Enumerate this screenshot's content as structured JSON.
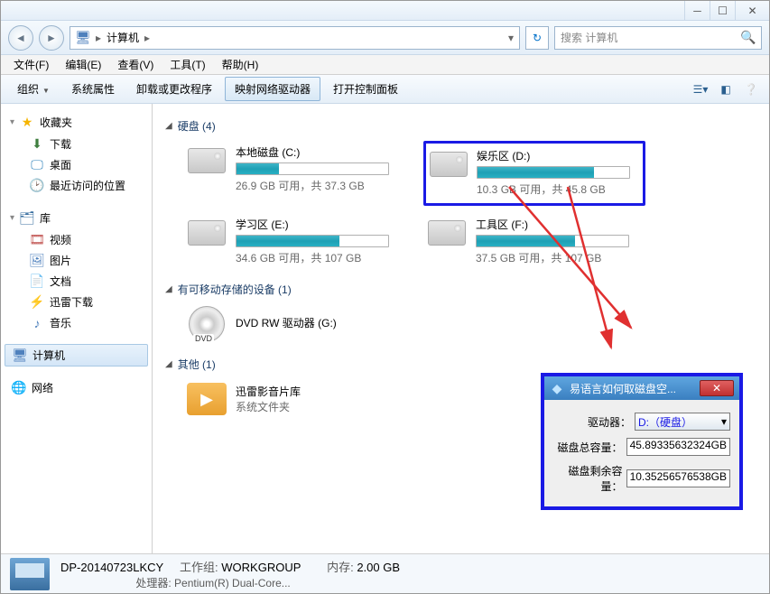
{
  "titlebar": {},
  "address": {
    "root": "计算机"
  },
  "search": {
    "placeholder": "搜索 计算机"
  },
  "menu": {
    "file": "文件(F)",
    "edit": "编辑(E)",
    "view": "查看(V)",
    "tools": "工具(T)",
    "help": "帮助(H)"
  },
  "cmd": {
    "organize": "组织",
    "props": "系统属性",
    "uninstall": "卸载或更改程序",
    "map": "映射网络驱动器",
    "cpanel": "打开控制面板"
  },
  "side": {
    "fav": "收藏夹",
    "downloads": "下载",
    "desktop": "桌面",
    "recent": "最近访问的位置",
    "libs": "库",
    "videos": "视频",
    "pictures": "图片",
    "docs": "文档",
    "thunder": "迅雷下载",
    "music": "音乐",
    "computer": "计算机",
    "network": "网络"
  },
  "sections": {
    "hdd_head": "硬盘 (4)",
    "removable_head": "有可移动存储的设备 (1)",
    "other_head": "其他 (1)"
  },
  "drives": {
    "c": {
      "name": "本地磁盘 (C:)",
      "stat": "26.9 GB 可用，共 37.3 GB",
      "pct": 28
    },
    "d": {
      "name": "娱乐区 (D:)",
      "stat": "10.3 GB 可用，共 45.8 GB",
      "pct": 77
    },
    "e": {
      "name": "学习区 (E:)",
      "stat": "34.6 GB 可用，共 107 GB",
      "pct": 68
    },
    "f": {
      "name": "工具区 (F:)",
      "stat": "37.5 GB 可用，共 107 GB",
      "pct": 65
    },
    "g": {
      "name": "DVD RW 驱动器 (G:)"
    }
  },
  "other": {
    "name": "迅雷影音片库",
    "sub": "系统文件夹"
  },
  "tool": {
    "title": "易语言如何取磁盘空...",
    "drive_label": "驱动器：",
    "drive_value": "D:（硬盘）",
    "total_label": "磁盘总容量：",
    "total_value": "45.89335632324GB",
    "free_label": "磁盘剩余容量：",
    "free_value": "10.35256576538GB"
  },
  "status": {
    "hostname": "DP-20140723LKCY",
    "wg_label": "工作组:",
    "wg_value": "WORKGROUP",
    "mem_label": "内存:",
    "mem_value": "2.00 GB",
    "cpu_label": "处理器:",
    "cpu_value": "Pentium(R) Dual-Core..."
  }
}
